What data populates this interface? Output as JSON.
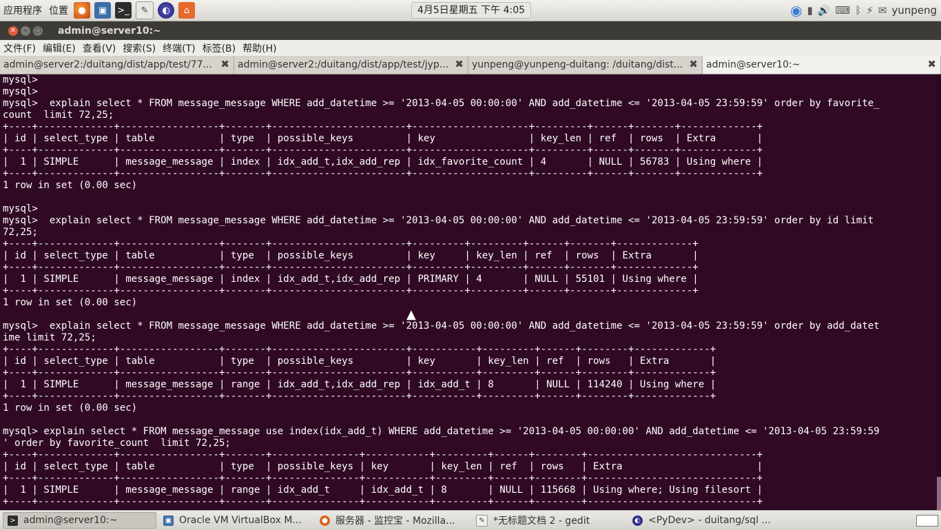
{
  "top_panel": {
    "menu_apps": "应用程序",
    "menu_places": "位置",
    "clock": "4月5日星期五 下午 4:05",
    "user": "yunpeng",
    "launchers": [
      "firefox-icon",
      "virtualbox-icon",
      "terminal-icon",
      "text-editor-icon",
      "eclipse-icon",
      "home-icon"
    ],
    "tray_icons": [
      "chromium-icon",
      "battery-icon",
      "volume-icon",
      "keyboard-icon",
      "bluetooth-icon",
      "network-icon",
      "chat-icon"
    ]
  },
  "window": {
    "title": "admin@server10:~",
    "menu": [
      "文件(F)",
      "编辑(E)",
      "查看(V)",
      "搜索(S)",
      "终端(T)",
      "标签(B)",
      "帮助(H)"
    ],
    "tabs": [
      {
        "label": "admin@server2:/duitang/dist/app/test/77..."
      },
      {
        "label": "admin@server2:/duitang/dist/app/test/jyp..."
      },
      {
        "label": "yunpeng@yunpeng-duitang: /duitang/dist..."
      },
      {
        "label": "admin@server10:~"
      }
    ]
  },
  "terminal": {
    "lines": [
      "mysql>",
      "mysql>",
      "mysql>  explain select * FROM message_message WHERE add_datetime >= '2013-04-05 00:00:00' AND add_datetime <= '2013-04-05 23:59:59' order by favorite_",
      "count  limit 72,25;",
      "+----+-------------+-----------------+-------+-----------------------+--------------------+---------+------+-------+-------------+",
      "| id | select_type | table           | type  | possible_keys         | key                | key_len | ref  | rows  | Extra       |",
      "+----+-------------+-----------------+-------+-----------------------+--------------------+---------+------+-------+-------------+",
      "|  1 | SIMPLE      | message_message | index | idx_add_t,idx_add_rep | idx_favorite_count | 4       | NULL | 56783 | Using where |",
      "+----+-------------+-----------------+-------+-----------------------+--------------------+---------+------+-------+-------------+",
      "1 row in set (0.00 sec)",
      "",
      "mysql>",
      "mysql>  explain select * FROM message_message WHERE add_datetime >= '2013-04-05 00:00:00' AND add_datetime <= '2013-04-05 23:59:59' order by id limit",
      "72,25;",
      "+----+-------------+-----------------+-------+-----------------------+---------+---------+------+-------+-------------+",
      "| id | select_type | table           | type  | possible_keys         | key     | key_len | ref  | rows  | Extra       |",
      "+----+-------------+-----------------+-------+-----------------------+---------+---------+------+-------+-------------+",
      "|  1 | SIMPLE      | message_message | index | idx_add_t,idx_add_rep | PRIMARY | 4       | NULL | 55101 | Using where |",
      "+----+-------------+-----------------+-------+-----------------------+---------+---------+------+-------+-------------+",
      "1 row in set (0.00 sec)",
      "",
      "mysql>  explain select * FROM message_message WHERE add_datetime >= '2013-04-05 00:00:00' AND add_datetime <= '2013-04-05 23:59:59' order by add_datet",
      "ime limit 72,25;",
      "+----+-------------+-----------------+-------+-----------------------+-----------+---------+------+--------+-------------+",
      "| id | select_type | table           | type  | possible_keys         | key       | key_len | ref  | rows   | Extra       |",
      "+----+-------------+-----------------+-------+-----------------------+-----------+---------+------+--------+-------------+",
      "|  1 | SIMPLE      | message_message | range | idx_add_t,idx_add_rep | idx_add_t | 8       | NULL | 114240 | Using where |",
      "+----+-------------+-----------------+-------+-----------------------+-----------+---------+------+--------+-------------+",
      "1 row in set (0.00 sec)",
      "",
      "mysql> explain select * FROM message_message use index(idx_add_t) WHERE add_datetime >= '2013-04-05 00:00:00' AND add_datetime <= '2013-04-05 23:59:59",
      "' order by favorite_count  limit 72,25;",
      "+----+-------------+-----------------+-------+---------------+-----------+---------+------+--------+-----------------------------+",
      "| id | select_type | table           | type  | possible_keys | key       | key_len | ref  | rows   | Extra                       |",
      "+----+-------------+-----------------+-------+---------------+-----------+---------+------+--------+-----------------------------+",
      "|  1 | SIMPLE      | message_message | range | idx_add_t     | idx_add_t | 8       | NULL | 115668 | Using where; Using filesort |",
      "+----+-------------+-----------------+-------+---------------+-----------+---------+------+--------+-----------------------------+"
    ]
  },
  "taskbar": {
    "tasks": [
      {
        "label": "admin@server10:~",
        "icon": "terminal-icon"
      },
      {
        "label": "Oracle VM VirtualBox M...",
        "icon": "virtualbox-icon"
      },
      {
        "label": "服务器 - 监控宝 - Mozilla...",
        "icon": "firefox-icon"
      },
      {
        "label": "*无标题文档 2 - gedit",
        "icon": "text-editor-icon"
      },
      {
        "label": "<PyDev> - duitang/sql ...",
        "icon": "eclipse-icon"
      }
    ]
  },
  "colors": {
    "terminal_bg": "#300a24",
    "terminal_fg": "#ffffff",
    "titlebar_bg": "#3c3b37",
    "close_button": "#e0573a"
  }
}
